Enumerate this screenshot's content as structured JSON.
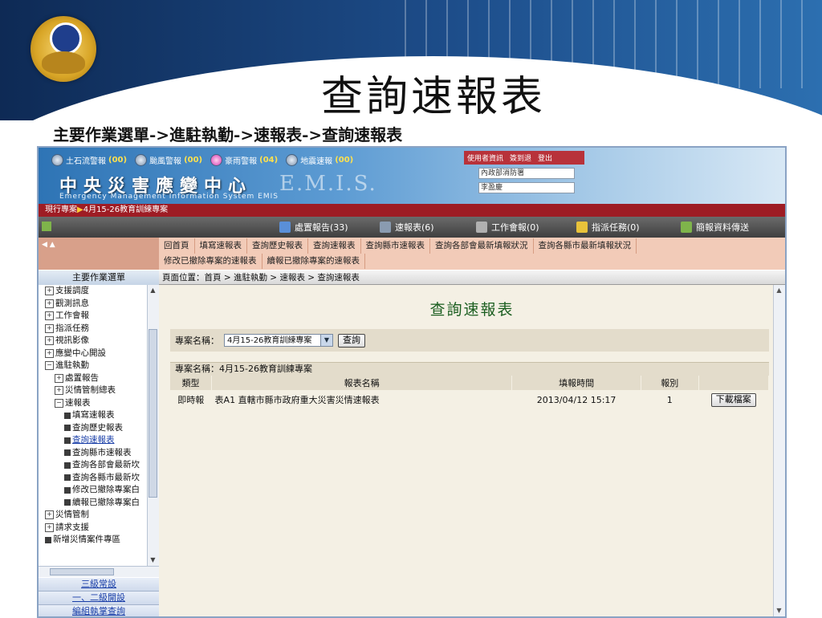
{
  "slide": {
    "title": "查詢速報表",
    "subtitle": "主要作業選單->進駐執勤->速報表->查詢速報表"
  },
  "app": {
    "alerts": [
      {
        "label": "土石流警報",
        "count": "(00)"
      },
      {
        "label": "颱風警報",
        "count": "(00)"
      },
      {
        "label": "豪雨警報",
        "count": "(04)"
      },
      {
        "label": "地震速報",
        "count": "(00)"
      }
    ],
    "system_name": "中央災害應變中心",
    "system_en": "Emergency Management Information System EMIS",
    "emis_watermark": "E.M.I.S.",
    "user_links": [
      "使用者資訊",
      "簽到退",
      "登出"
    ],
    "user_org": "內政部消防署",
    "user_name": "李盈慶",
    "project_label": "現行專案",
    "project_name": "4月15-26教育訓練專案",
    "toolbar": [
      {
        "label": "處置報告(33)",
        "color": "#5a8fd8"
      },
      {
        "label": "速報表(6)",
        "color": "#8a9bb0"
      },
      {
        "label": "工作會報(0)",
        "color": "#b0b0b0"
      },
      {
        "label": "指派任務(0)",
        "color": "#e8c23a"
      },
      {
        "label": "簡報資料傳送",
        "color": "#7fb44b"
      }
    ],
    "subnav_left": "◀ ▲",
    "subnav_row1": [
      "回首頁",
      "填寫速報表",
      "查詢歷史報表",
      "查詢速報表",
      "查詢縣市速報表",
      "查詢各部會最新填報狀況",
      "查詢各縣市最新填報狀況"
    ],
    "subnav_row2": [
      "修改已撤除專案的速報表",
      "續報已撤除專案的速報表"
    ]
  },
  "sidebar": {
    "title": "主要作業選單",
    "tree": [
      {
        "label": "支援調度",
        "level": 0,
        "mark": "+"
      },
      {
        "label": "觀測訊息",
        "level": 0,
        "mark": "+"
      },
      {
        "label": "工作會報",
        "level": 0,
        "mark": "+"
      },
      {
        "label": "指派任務",
        "level": 0,
        "mark": "+"
      },
      {
        "label": "視訊影像",
        "level": 0,
        "mark": "+"
      },
      {
        "label": "應變中心開設",
        "level": 0,
        "mark": "+"
      },
      {
        "label": "進駐執勤",
        "level": 0,
        "mark": "-"
      },
      {
        "label": "處置報告",
        "level": 1,
        "mark": "+"
      },
      {
        "label": "災情管制總表",
        "level": 1,
        "mark": "+"
      },
      {
        "label": "速報表",
        "level": 1,
        "mark": "-"
      },
      {
        "label": "填寫速報表",
        "level": 2,
        "mark": "sq"
      },
      {
        "label": "查詢歷史報表",
        "level": 2,
        "mark": "sq"
      },
      {
        "label": "查詢速報表",
        "level": 2,
        "mark": "sq",
        "selected": true
      },
      {
        "label": "查詢縣市速報表",
        "level": 2,
        "mark": "sq"
      },
      {
        "label": "查詢各部會最新坎",
        "level": 2,
        "mark": "sq"
      },
      {
        "label": "查詢各縣市最新坎",
        "level": 2,
        "mark": "sq"
      },
      {
        "label": "修改已撤除專案白",
        "level": 2,
        "mark": "sq"
      },
      {
        "label": "續報已撤除專案白",
        "level": 2,
        "mark": "sq"
      },
      {
        "label": "災情管制",
        "level": 0,
        "mark": "+"
      },
      {
        "label": "請求支援",
        "level": 0,
        "mark": "+"
      },
      {
        "label": "新增災情案件專區",
        "level": 0,
        "mark": "sq"
      }
    ],
    "links": [
      "三級常設",
      "一、二級開設",
      "編組執掌查詢"
    ]
  },
  "main": {
    "breadcrumb": "頁面位置：首頁 > 進駐執勤 > 速報表 > 查詢速報表",
    "title": "查詢速報表",
    "filter_label": "專案名稱：",
    "filter_value": "4月15-26教育訓練專案",
    "query_button": "查詢",
    "result_header": "專案名稱：4月15-26教育訓練專案",
    "columns": [
      "類型",
      "報表名稱",
      "填報時間",
      "報別",
      ""
    ],
    "rows": [
      {
        "type": "即時報",
        "name": "表A1 直轄市縣市政府重大災害災情速報表",
        "time": "2013/04/12 15:17",
        "seq": "1",
        "action": "下載檔案"
      }
    ]
  }
}
